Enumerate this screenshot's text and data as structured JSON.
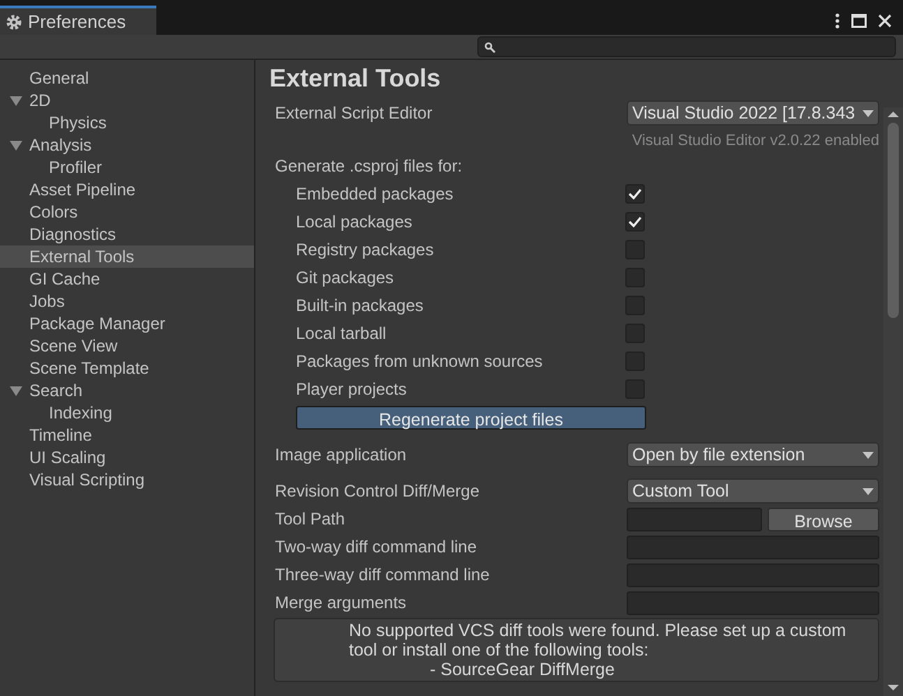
{
  "window": {
    "title": "Preferences"
  },
  "sidebar": {
    "items": [
      {
        "label": "General",
        "selected": false
      },
      {
        "label": "2D",
        "selected": false,
        "expanded": true,
        "children": [
          {
            "label": "Physics",
            "selected": false
          }
        ]
      },
      {
        "label": "Analysis",
        "selected": false,
        "expanded": true,
        "children": [
          {
            "label": "Profiler",
            "selected": false
          }
        ]
      },
      {
        "label": "Asset Pipeline",
        "selected": false
      },
      {
        "label": "Colors",
        "selected": false
      },
      {
        "label": "Diagnostics",
        "selected": false
      },
      {
        "label": "External Tools",
        "selected": true
      },
      {
        "label": "GI Cache",
        "selected": false
      },
      {
        "label": "Jobs",
        "selected": false
      },
      {
        "label": "Package Manager",
        "selected": false
      },
      {
        "label": "Scene View",
        "selected": false
      },
      {
        "label": "Scene Template",
        "selected": false
      },
      {
        "label": "Search",
        "selected": false,
        "expanded": true,
        "children": [
          {
            "label": "Indexing",
            "selected": false
          }
        ]
      },
      {
        "label": "Timeline",
        "selected": false
      },
      {
        "label": "UI Scaling",
        "selected": false
      },
      {
        "label": "Visual Scripting",
        "selected": false
      }
    ]
  },
  "content": {
    "title": "External Tools",
    "script_editor": {
      "label": "External Script Editor",
      "value": "Visual Studio 2022 [17.8.343",
      "note": "Visual Studio Editor v2.0.22 enabled"
    },
    "generate_label": "Generate .csproj files for:",
    "packages": [
      {
        "label": "Embedded packages",
        "checked": true
      },
      {
        "label": "Local packages",
        "checked": true
      },
      {
        "label": "Registry packages",
        "checked": false
      },
      {
        "label": "Git packages",
        "checked": false
      },
      {
        "label": "Built-in packages",
        "checked": false
      },
      {
        "label": "Local tarball",
        "checked": false
      },
      {
        "label": "Packages from unknown sources",
        "checked": false
      },
      {
        "label": "Player projects",
        "checked": false
      }
    ],
    "regenerate_button": "Regenerate project files",
    "image_application": {
      "label": "Image application",
      "value": "Open by file extension"
    },
    "revision_control": {
      "label": "Revision Control Diff/Merge",
      "value": "Custom Tool"
    },
    "tool_path": {
      "label": "Tool Path",
      "button": "Browse"
    },
    "fields": [
      {
        "label": "Two-way diff command line"
      },
      {
        "label": "Three-way diff command line"
      },
      {
        "label": "Merge arguments"
      }
    ],
    "help_lines": [
      "No supported VCS diff tools were found. Please set up a custom tool or install one of the following tools:",
      "- SourceGear DiffMerge"
    ]
  }
}
